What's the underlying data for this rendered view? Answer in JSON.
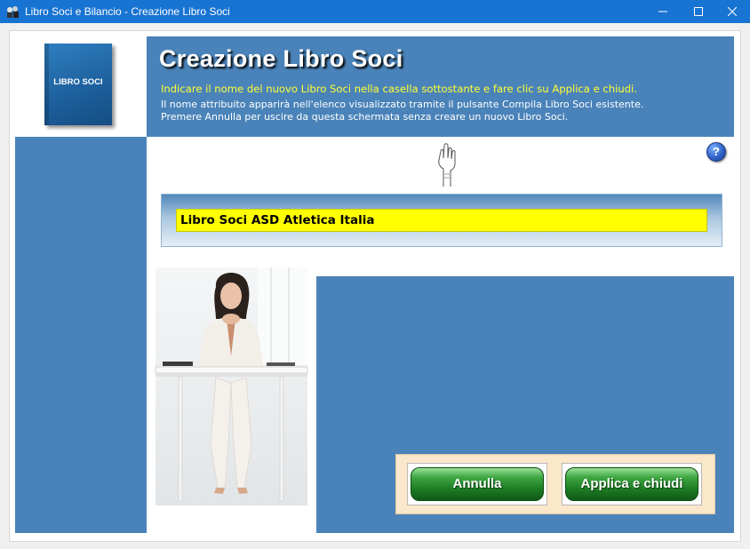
{
  "window": {
    "title": "Libro Soci e Bilancio - Creazione Libro Soci"
  },
  "logo": {
    "book_label": "LIBRO SOCI"
  },
  "header": {
    "title": "Creazione Libro Soci",
    "instruction_highlight": "Indicare il nome del nuovo Libro Soci nella casella sottostante e fare clic su Applica e chiudi.",
    "instruction_line2": "Il nome attribuito apparirà nell'elenco visualizzato tramite il pulsante Compila Libro Soci esistente.",
    "instruction_line3": "Premere Annulla per uscire da questa schermata senza creare un nuovo Libro Soci."
  },
  "help": {
    "label": "?"
  },
  "form": {
    "name_value": "Libro Soci ASD Atletica Italia"
  },
  "buttons": {
    "cancel_label": "Annulla",
    "apply_label": "Applica e chiudi"
  },
  "colors": {
    "titlebar": "#1874d2",
    "panel_blue": "#4a83b9",
    "input_yellow": "#ffff00",
    "highlight_text": "#ffff33",
    "button_panel": "#fbe7c9",
    "button_green": "#1f7f26"
  }
}
